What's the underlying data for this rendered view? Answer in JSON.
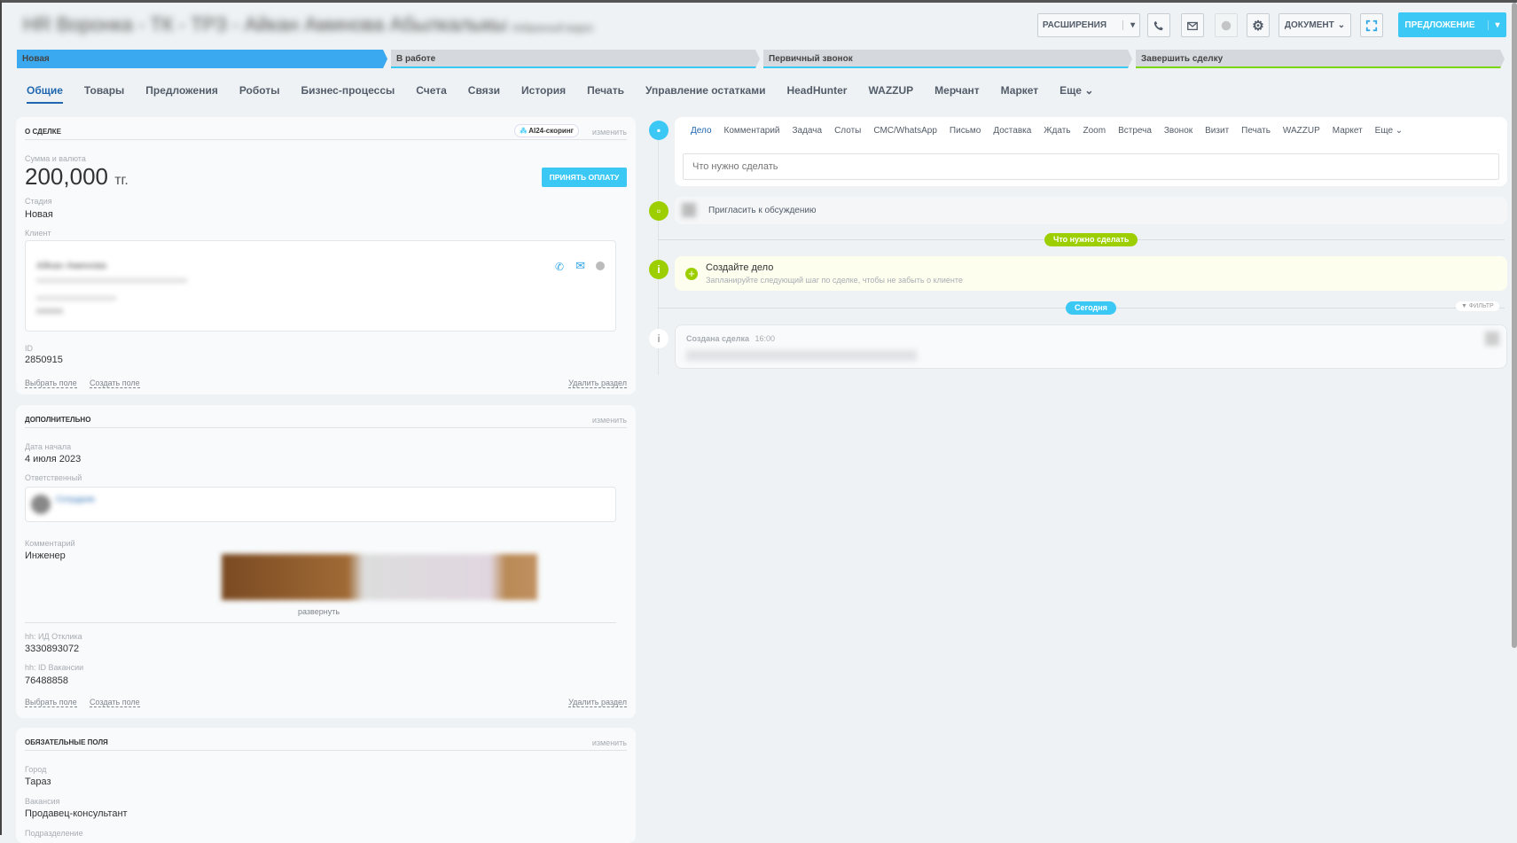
{
  "header": {
    "title": "HR Воронка - ТК - ТРЗ - Айкан Аминова Абылкалыкы",
    "subtitle": "Избранный видно",
    "extensions": "РАСШИРЕНИЯ",
    "document": "ДОКУМЕНТ",
    "offer": "ПРЕДЛОЖЕНИЕ"
  },
  "stages": [
    {
      "label": "Новая",
      "color": "#3ba9ef"
    },
    {
      "label": "В работе",
      "color": "#3bc8f5"
    },
    {
      "label": "Первичный звонок",
      "color": "#3bc8f5"
    },
    {
      "label": "Завершить сделку",
      "color": "#7bd500"
    }
  ],
  "tabs": [
    "Общие",
    "Товары",
    "Предложения",
    "Роботы",
    "Бизнес-процессы",
    "Счета",
    "Связи",
    "История",
    "Печать",
    "Управление остатками",
    "HeadHunter",
    "WAZZUP",
    "Мерчант",
    "Маркет",
    "Еще"
  ],
  "about": {
    "title": "о сделке",
    "ai": "AI24-скоринг",
    "edit": "изменить",
    "amount_label": "Сумма и валюта",
    "amount": "200,000",
    "currency": "тг.",
    "pay": "ПРИНЯТЬ ОПЛАТУ",
    "stage_label": "Стадия",
    "stage": "Новая",
    "client_label": "Клиент",
    "client_name": "Айкан Аминова",
    "id_label": "ID",
    "id": "2850915",
    "choose": "Выбрать поле",
    "create": "Создать поле",
    "delete": "Удалить раздел"
  },
  "extra": {
    "title": "дополнительно",
    "edit": "изменить",
    "date_label": "Дата начала",
    "date": "4 июля 2023",
    "resp_label": "Ответственный",
    "resp_name": "Сотрудник",
    "comment_label": "Комментарий",
    "comment": "Инженер",
    "expand": "развернуть",
    "hh1_label": "hh: ИД Отклика",
    "hh1": "3330893072",
    "hh2_label": "hh: ID Вакансии",
    "hh2": "76488858",
    "choose": "Выбрать поле",
    "create": "Создать поле",
    "delete": "Удалить раздел"
  },
  "required": {
    "title": "обязательные поля",
    "edit": "изменить",
    "city_label": "Город",
    "city": "Тараз",
    "vac_label": "Вакансия",
    "vac": "Продавец-консультант",
    "dep_label": "Подразделение"
  },
  "timeline": {
    "tabs": [
      "Дело",
      "Комментарий",
      "Задача",
      "Слоты",
      "СМС/WhatsApp",
      "Письмо",
      "Доставка",
      "Ждать",
      "Zoom",
      "Встреча",
      "Звонок",
      "Визит",
      "Печать",
      "WAZZUP",
      "Маркет",
      "Еще"
    ],
    "placeholder": "Что нужно сделать",
    "invite": "Пригласить к обсуждению",
    "todo_pill": "Что нужно сделать",
    "create_title": "Создайте дело",
    "create_hint": "Запланируйте следующий шаг по сделке, чтобы не забыть о клиенте",
    "today": "Сегодня",
    "filter": "ФИЛЬТР",
    "created": "Создана сделка",
    "created_time": "16:00"
  }
}
